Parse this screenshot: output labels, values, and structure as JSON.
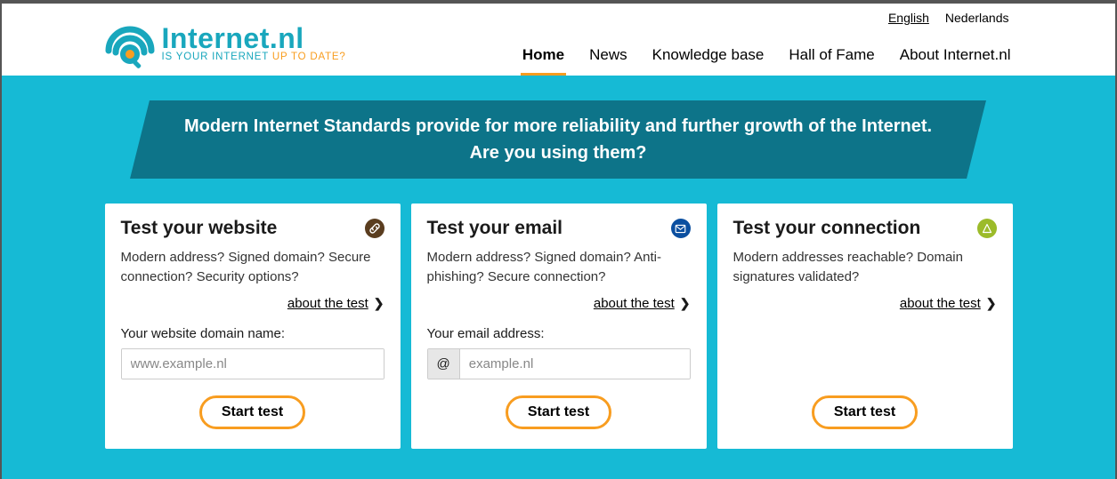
{
  "logo": {
    "title": "Internet.nl",
    "sub_part1": "IS YOUR INTERNET ",
    "sub_part2": "UP TO DATE?"
  },
  "lang": {
    "english": "English",
    "dutch": "Nederlands"
  },
  "nav": {
    "home": "Home",
    "news": "News",
    "kb": "Knowledge base",
    "hof": "Hall of Fame",
    "about": "About Internet.nl"
  },
  "tagline": {
    "line1": "Modern Internet Standards provide for more reliability and further growth of the Internet.",
    "line2": "Are you using them?"
  },
  "cards": {
    "website": {
      "title": "Test your website",
      "desc": "Modern address? Signed domain? Secure connection? Security options?",
      "about": "about the test",
      "input_label": "Your website domain name:",
      "placeholder": "www.example.nl",
      "button": "Start test"
    },
    "email": {
      "title": "Test your email",
      "desc": "Modern address? Signed domain? Anti-phishing? Secure connection?",
      "about": "about the test",
      "input_label": "Your email address:",
      "prefix": "@",
      "placeholder": "example.nl",
      "button": "Start test"
    },
    "connection": {
      "title": "Test your connection",
      "desc": "Modern addresses reachable? Domain signatures validated?",
      "about": "about the test",
      "button": "Start test"
    }
  }
}
